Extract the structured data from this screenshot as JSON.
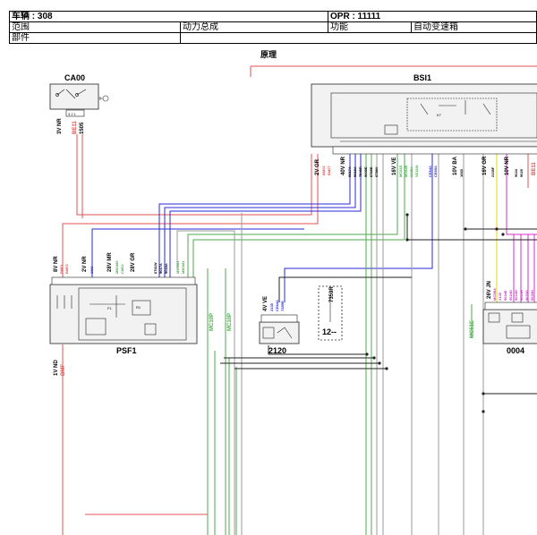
{
  "header": {
    "vehicle": "车辆 : 308",
    "opr": "OPR : 11111",
    "scope_label": "范围",
    "scope_value": "动力总成",
    "function_label": "功能",
    "function_value": "自动变速箱",
    "part_label": "部件",
    "section_title": "原理"
  },
  "components": {
    "ca00": "CA00",
    "bsi1": "BSI1",
    "psf1": "PSF1",
    "c2120": "2120",
    "c0004": "0004",
    "connector12": "12--"
  },
  "connector_labels": {
    "ca00_conn": "3V NR",
    "ca00_wire1": "BE11",
    "ca00_wire2": "1505",
    "bsi_2vgr": "2V GR",
    "bsi_40vnr": "40V NR",
    "bsi_16vve": "16V VE",
    "bsi_10vba": "10V BA",
    "bsi_16vgr": "16V GR",
    "bsi_10vnr": "10V NR",
    "psf_8vnr": "8V NR",
    "psf_2vnr": "2V NR",
    "psf_28vmr": "28V MR",
    "psf_28vgr": "28V GR",
    "psf_1vnd": "1V ND",
    "c2120_conn": "4V VE",
    "c0004_conn": "26V JN",
    "mc51e": "MC51E",
    "mc10p": "MC10P",
    "mc10p_b": "MC10P",
    "bmf": "BMF",
    "bsi_tag": "BE11",
    "conn12_code": "7359R"
  },
  "wire_codes": {
    "bsi_a": [
      "BM01",
      "BM07"
    ],
    "bsi_b": [
      "9017A",
      "9018A",
      "7549R",
      "9009E",
      "6769E",
      "6788V"
    ],
    "bsi_c": [
      "MC81E",
      "MC82E",
      "2135A",
      "VE16W"
    ],
    "bsi_d": [
      "CE84A",
      "CE85A"
    ],
    "bsi_e": [
      "1065"
    ],
    "bsi_f": [
      "2135F"
    ],
    "bsi_g": [
      "9024",
      "9025"
    ],
    "psf_a": [
      "BM01",
      "BM03"
    ],
    "psf_b": [
      "CM3"
    ],
    "psf_c": [
      "MBSM5",
      "CM02"
    ],
    "psf_d": [
      "6761W",
      "9017A",
      "9018A"
    ],
    "psf_e": [
      "MBSM2",
      "MBSM1"
    ],
    "c2120_w": [
      "2135",
      "CE84A",
      "7359R"
    ],
    "c0004_w": [
      "MC5B4",
      "2135",
      "9024E",
      "9024G",
      "9024H",
      "9025H",
      "9025G",
      "9025H"
    ]
  },
  "colors": {
    "red": "#e05050",
    "blue": "#2a2ad6",
    "green": "#4caa4c",
    "yellow": "#e8d400",
    "magenta": "#d030c8",
    "gray": "#9a9a9a",
    "black": "#222222",
    "box_fill": "#f2f2f2"
  }
}
